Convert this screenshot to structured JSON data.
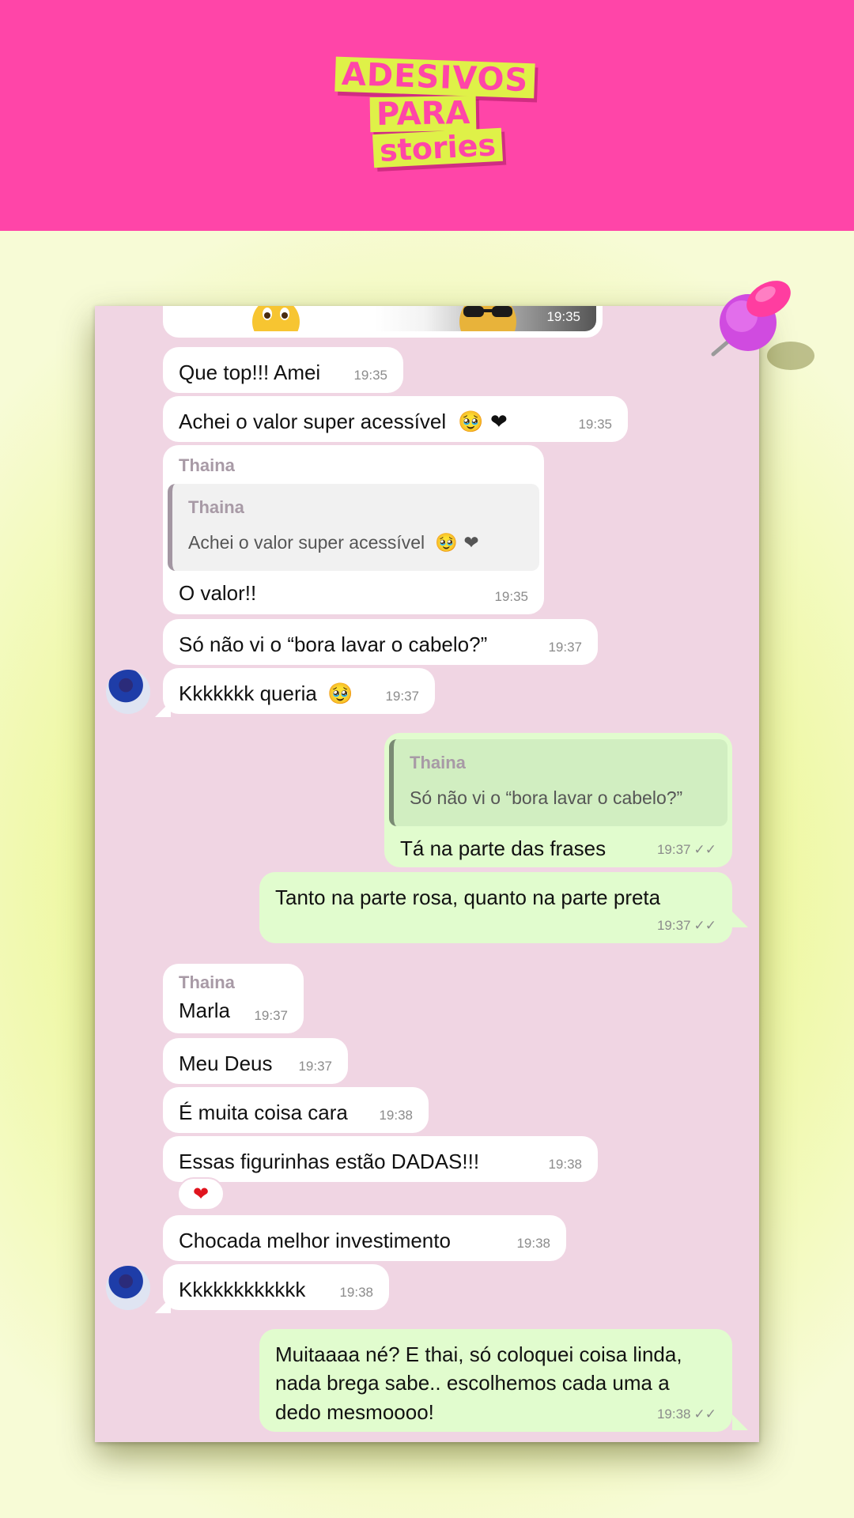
{
  "logo": {
    "line1": "ADESIVOS",
    "line2": "PARA",
    "line3": "stories"
  },
  "colors": {
    "banner": "#ff45a8",
    "card": "#f0d5e3",
    "incoming": "#ffffff",
    "outgoing": "#e1fcce",
    "accent": "#dff148"
  },
  "chat": {
    "sticker_time": "19:35",
    "m1": {
      "text": "Que top!!! Amei",
      "time": "19:35"
    },
    "m2": {
      "text": "Achei o valor super acessível",
      "emoji": "🥹 ❤",
      "time": "19:35"
    },
    "m3": {
      "sender": "Thaina",
      "quote_name": "Thaina",
      "quote_text": "Achei o valor super acessível",
      "quote_emoji": "🥹 ❤",
      "text": "O valor!!",
      "time": "19:35"
    },
    "m4": {
      "text": "Só não vi o “bora lavar o cabelo?”",
      "time": "19:37"
    },
    "m5": {
      "text": "Kkkkkkk queria",
      "emoji": "🥹",
      "time": "19:37"
    },
    "m6": {
      "quote_name": "Thaina",
      "quote_text": "Só não vi o “bora lavar o cabelo?”",
      "text": "Tá na parte das frases",
      "time": "19:37"
    },
    "m7": {
      "text": "Tanto na parte rosa, quanto na parte preta",
      "time": "19:37"
    },
    "m8": {
      "sender": "Thaina",
      "text": "Marla",
      "time": "19:37"
    },
    "m9": {
      "text": "Meu Deus",
      "time": "19:37"
    },
    "m10": {
      "text": "É muita coisa cara",
      "time": "19:38"
    },
    "m11": {
      "text": "Essas figurinhas estão DADAS!!!",
      "time": "19:38",
      "reaction": "❤"
    },
    "m12": {
      "text": "Chocada melhor investimento",
      "time": "19:38"
    },
    "m13": {
      "text": "Kkkkkkkkkkkk",
      "time": "19:38"
    },
    "m14": {
      "text": "Muitaaaa né? E thai, só coloquei coisa linda, nada brega sabe.. escolhemos cada uma a dedo mesmoooo!",
      "time": "19:38"
    },
    "read_ticks": "✓✓"
  }
}
